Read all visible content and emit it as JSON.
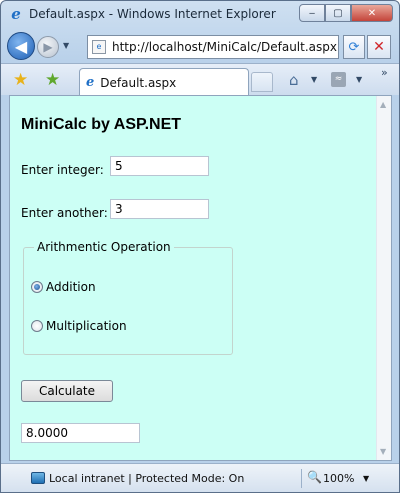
{
  "window": {
    "title": "Default.aspx - Windows Internet Explorer",
    "minimize_glyph": "‒",
    "maximize_glyph": "▢",
    "close_glyph": "✕"
  },
  "toolbar": {
    "back_glyph": "◀",
    "forward_glyph": "▶",
    "dropdown_glyph": "▼",
    "url": "http://localhost/MiniCalc/Default.aspx",
    "refresh_glyph": "⟳",
    "stop_glyph": "✕"
  },
  "tabs": {
    "favorites_glyph": "★",
    "add_favorite_glyph": "★",
    "active_tab_label": "Default.aspx",
    "home_glyph": "⌂",
    "feeds_glyph": "≈",
    "more_glyph": "»"
  },
  "page": {
    "title": "MiniCalc by ASP.NET",
    "integer_label": "Enter integer:",
    "integer_value": "5",
    "another_label": "Enter another:",
    "another_value": "3",
    "operation_legend": "Arithmentic Operation",
    "option_addition": "Addition",
    "option_multiplication": "Multiplication",
    "selected_operation": "Addition",
    "calculate_label": "Calculate",
    "result_value": "8.0000"
  },
  "statusbar": {
    "zone_text": "Local intranet | Protected Mode: On",
    "zoom_glyph": "🔍",
    "zoom_text": "100%",
    "zoom_drop_glyph": "▼"
  },
  "colors": {
    "page_background": "#ccfff5",
    "chrome_blue": "#b9d1ea"
  }
}
